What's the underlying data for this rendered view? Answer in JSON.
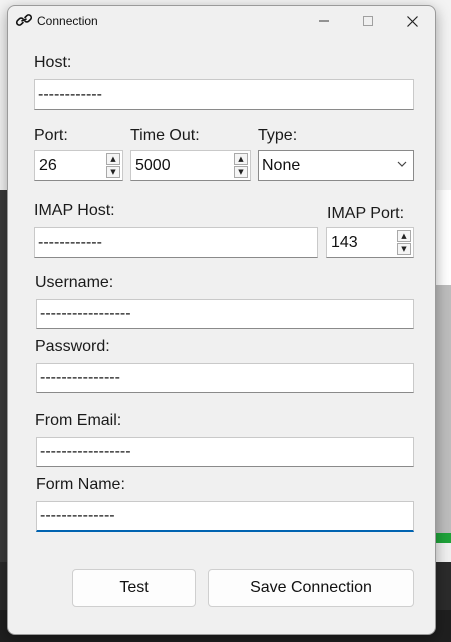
{
  "window": {
    "title": "Connection",
    "icon": "link-icon"
  },
  "host": {
    "label": "Host:",
    "value": "------------"
  },
  "port": {
    "label": "Port:",
    "value": "26"
  },
  "timeout": {
    "label": "Time Out:",
    "value": "5000"
  },
  "type": {
    "label": "Type:",
    "value": "None"
  },
  "imap_host": {
    "label": "IMAP Host:",
    "value": "------------"
  },
  "imap_port": {
    "label": "IMAP Port:",
    "value": "143"
  },
  "username": {
    "label": "Username:",
    "value": "-----------------"
  },
  "password": {
    "label": "Password:",
    "value": "---------------"
  },
  "from_email": {
    "label": "From Email:",
    "value": "-----------------"
  },
  "form_name": {
    "label": "Form Name:",
    "value": "--------------"
  },
  "buttons": {
    "test": "Test",
    "save": "Save Connection"
  },
  "colors": {
    "accent": "#0063b1",
    "dialog_bg": "#f0f0f0"
  }
}
